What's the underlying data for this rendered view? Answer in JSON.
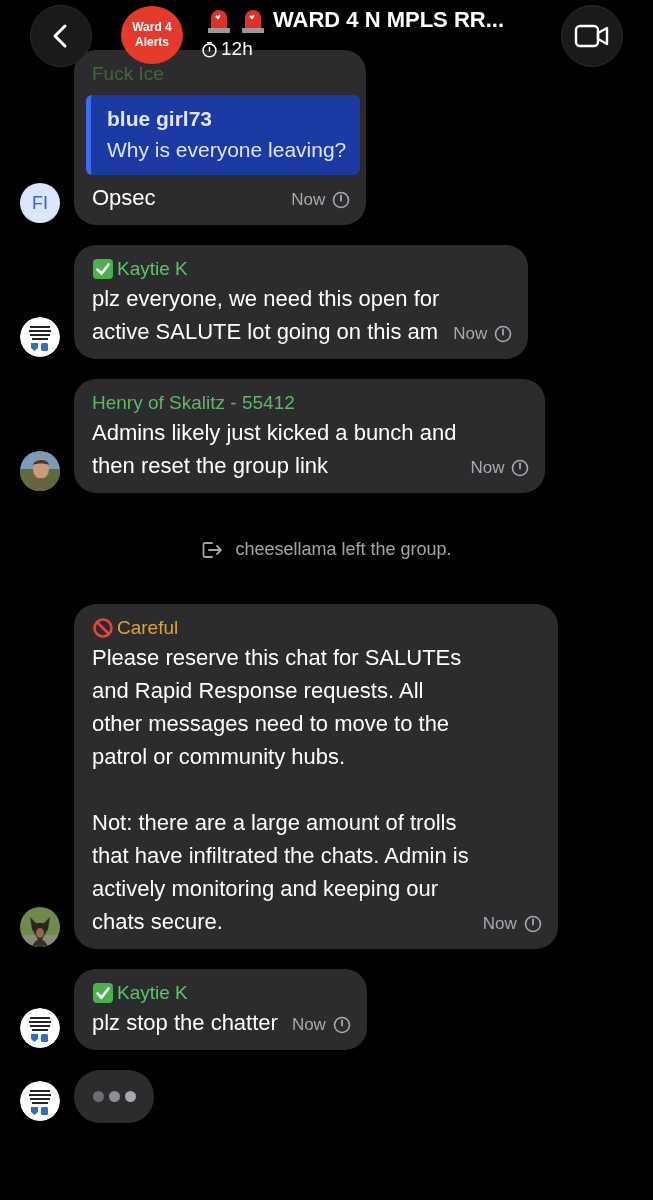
{
  "header": {
    "group_avatar": "Ward 4\nAlerts",
    "title": "WARD 4 N MPLS RR...",
    "timer": "12h"
  },
  "messages": [
    {
      "kind": "message",
      "avatar": {
        "kind": "initials",
        "text": "FI"
      },
      "sender": "Fuck Ice",
      "color": "#3f6b30",
      "quote": {
        "author": "blue girl73",
        "text": "Why is everyone leaving?"
      },
      "text": "Opsec",
      "time": "Now"
    },
    {
      "kind": "message",
      "avatar": {
        "kind": "logo"
      },
      "sender": "Kaytie K",
      "color": "#5cc46a",
      "sender_badge": {
        "kind": "check"
      },
      "text": "plz everyone, we need this open for\nactive SALUTE lot going on this am",
      "time": "Now"
    },
    {
      "kind": "message",
      "sender": "Henry of Skalitz - 55412",
      "color": "#62b468",
      "text": "Admins likely just kicked a bunch and\nthen reset the group link",
      "time": "Now"
    },
    {
      "kind": "system",
      "text": "cheesellama left the group."
    },
    {
      "kind": "message",
      "avatar": {
        "kind": "pet"
      },
      "sender": "Careful",
      "color": "#dca338",
      "sender_badge": {
        "kind": "prohibited"
      },
      "text": "Please reserve this chat for SALUTEs\nand Rapid Response requests. All\nother messages need to move to the\npatrol or community hubs.\n\nNot: there are a large amount of trolls\nthat have infiltrated the chats. Admin is\nactively monitoring and keeping our\nchats secure.",
      "time": "Now"
    },
    {
      "kind": "message",
      "avatar": {
        "kind": "logo"
      },
      "sender": "Kaytie K",
      "color": "#5cc46a",
      "sender_badge": {
        "kind": "check"
      },
      "text": "plz stop the chatter",
      "time": "Now"
    },
    {
      "kind": "typing",
      "avatar": {
        "kind": "logo"
      }
    }
  ]
}
